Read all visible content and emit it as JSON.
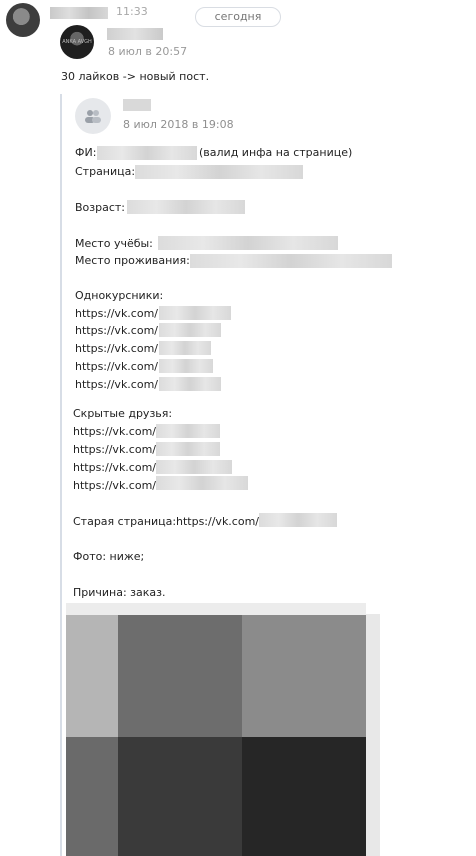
{
  "message": {
    "time": "11:33",
    "date_pill": "сегодня"
  },
  "repost": {
    "date": "8 июл в 20:57",
    "text": "30 лайков -> новый пост.",
    "avatar_label": "ANKA AVGH"
  },
  "quoted_post": {
    "date": "8 июл 2018 в 19:08",
    "fi_label": "ФИ:",
    "fi_note": "(валид инфа на странице)",
    "page_label": "Страница:",
    "age_label": "Возраст:",
    "study_label": "Место учёбы:",
    "residence_label": "Место проживания:",
    "classmates_label": "Однокурсники:",
    "classmates_links": [
      "https://vk.com/",
      "https://vk.com/",
      "https://vk.com/",
      "https://vk.com/",
      "https://vk.com/"
    ],
    "hidden_friends_label": "Скрытые друзья:",
    "hidden_friends_links": [
      "https://vk.com/",
      "https://vk.com/",
      "https://vk.com/",
      "https://vk.com/"
    ],
    "old_page_label": "Старая страница:",
    "old_page_link": "https://vk.com/",
    "photo_text": "Фото: ниже;",
    "reason_text": "Причина: заказ."
  }
}
